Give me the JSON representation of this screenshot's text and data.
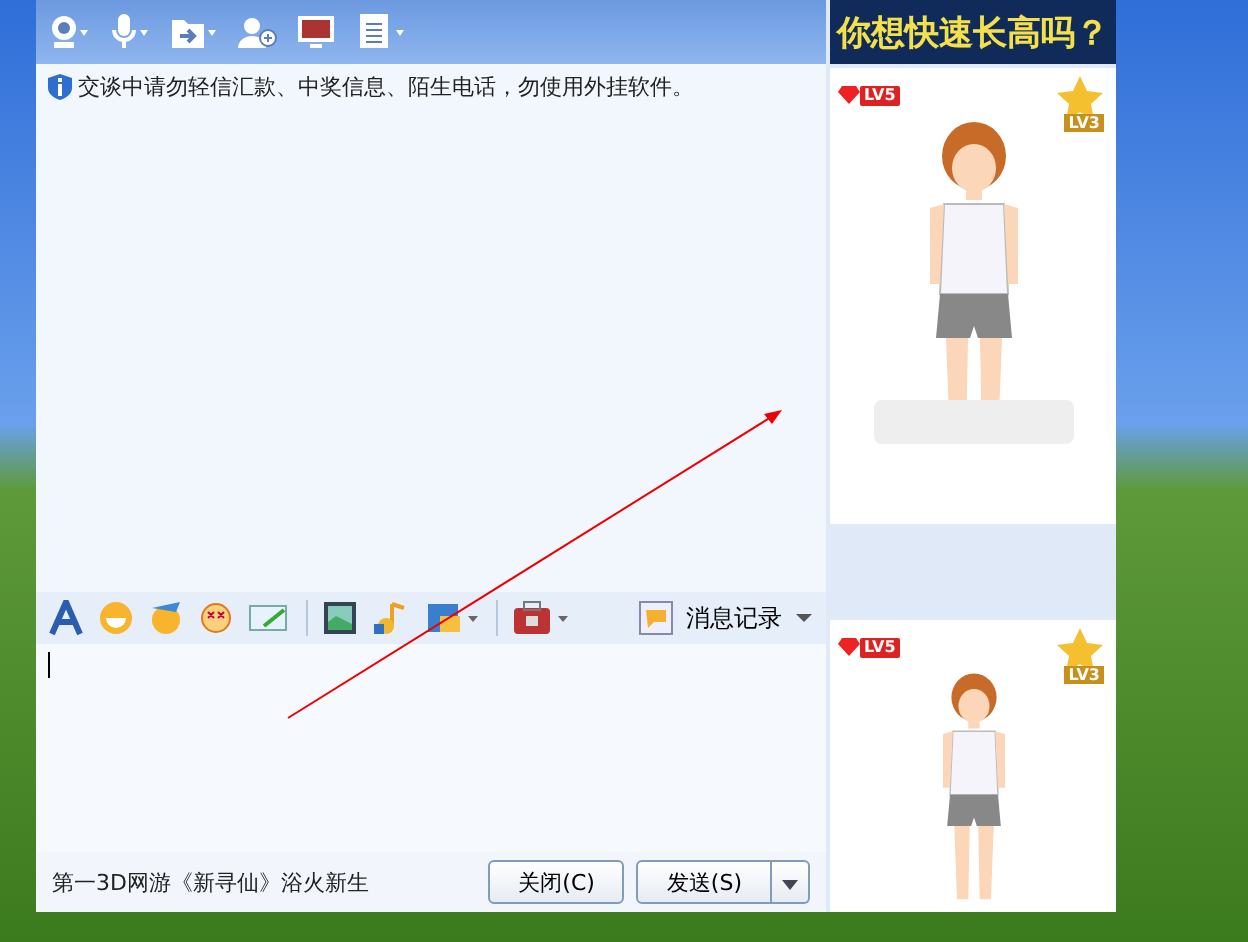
{
  "banner": {
    "text": "你想快速长高吗？"
  },
  "notice": {
    "text": "交谈中请勿轻信汇款、中奖信息、陌生电话，勿使用外挂软件。"
  },
  "input_toolbar": {
    "history_label": "消息记录"
  },
  "footer": {
    "ad_text": "第一3D网游《新寻仙》浴火新生",
    "buttons": [
      {
        "label": "关闭(C)",
        "kind": "plain"
      },
      {
        "label": "发送(S)",
        "kind": "split"
      }
    ]
  },
  "avatar_cards": [
    {
      "vip_badge": "LV5",
      "star_badge": "LV3"
    },
    {
      "vip_badge": "LV5",
      "star_badge": "LV3"
    }
  ]
}
